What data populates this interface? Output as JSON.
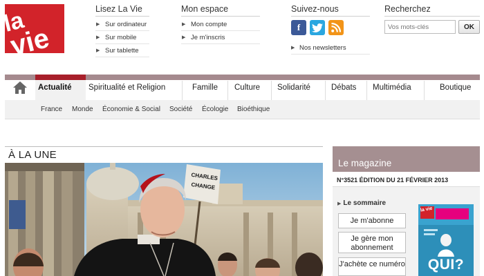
{
  "logo": {
    "text": "la vie"
  },
  "header": {
    "lisez": {
      "title": "Lisez La Vie",
      "items": [
        {
          "label": "Sur ordinateur"
        },
        {
          "label": "Sur mobile"
        },
        {
          "label": "Sur tablette"
        }
      ]
    },
    "espace": {
      "title": "Mon espace",
      "items": [
        {
          "label": "Mon compte"
        },
        {
          "label": "Je m'inscris"
        }
      ]
    },
    "suivez": {
      "title": "Suivez-nous",
      "icons": [
        "facebook-icon",
        "twitter-icon",
        "rss-icon"
      ],
      "newsletter": "Nos newsletters"
    },
    "search": {
      "title": "Recherchez",
      "placeholder": "Vos mots-clés",
      "button": "OK"
    }
  },
  "nav": {
    "items": [
      {
        "label": "Actualité",
        "active": true
      },
      {
        "label": "Spiritualité et Religion"
      },
      {
        "label": "Famille"
      },
      {
        "label": "Culture"
      },
      {
        "label": "Solidarité"
      },
      {
        "label": "Débats"
      },
      {
        "label": "Multimédia"
      },
      {
        "label": "Boutique"
      }
    ],
    "sub": [
      "France",
      "Monde",
      "Économie & Social",
      "Société",
      "Écologie",
      "Bioéthique"
    ]
  },
  "une": {
    "title": "À LA UNE"
  },
  "magazine": {
    "title": "Le magazine",
    "edition": "N°3521 ÉDITION DU 21 FÉVRIER 2013",
    "sommaire": "Le sommaire",
    "buttons": [
      "Je m'abonne",
      "Je gère mon abonnement",
      "J'achète ce numéro"
    ],
    "cover": {
      "logo": "la vie",
      "question": "QUI?"
    }
  },
  "colors": {
    "brand_red": "#d2232a",
    "active_bar": "#a71f2a",
    "magazine_header": "#a58f91"
  }
}
